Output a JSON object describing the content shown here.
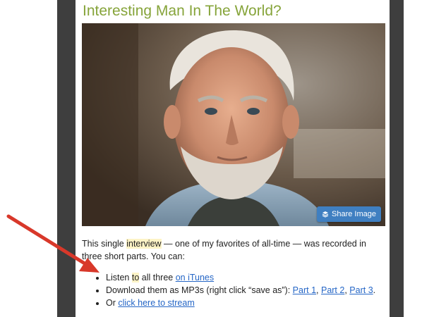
{
  "article": {
    "title": "Interesting Man In The World?",
    "share_button_label": "Share Image",
    "intro": {
      "before": "This single ",
      "highlight": "interview",
      "after": " — one of my favorites of all-time — was recorded in three short parts.  You can:"
    },
    "list": [
      {
        "prefix": "Listen ",
        "highlight": "to",
        "middle": " all three ",
        "link": "on iTunes"
      },
      {
        "prefix": "Download them as MP3s (right click “save as”): ",
        "links": [
          "Part 1",
          "Part 2",
          "Part 3"
        ],
        "sep": ", ",
        "suffix": "."
      },
      {
        "prefix": "Or ",
        "link": "click here to stream"
      }
    ]
  },
  "colors": {
    "title": "#86a43a",
    "link": "#2566c6",
    "share_button": "#3f7fc1",
    "sidebar": "#3e3e3e",
    "arrow": "#d8382a",
    "highlight": "#fdf3c6"
  }
}
